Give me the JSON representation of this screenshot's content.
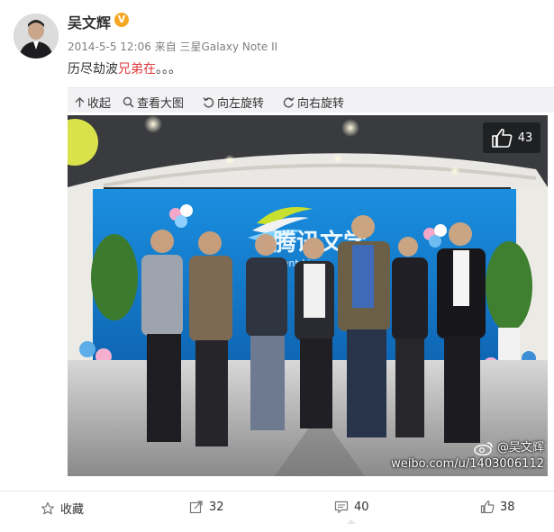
{
  "post": {
    "author": "吴文辉",
    "verified_badge": "V",
    "timestamp": "2014-5-5 12:06",
    "source_prefix": "来自",
    "source_device": "三星Galaxy Note II",
    "text_before": "历尽劫波",
    "text_highlight": "兄弟在",
    "text_after": "。。。"
  },
  "toolbar": {
    "collapse": "收起",
    "view_large": "查看大图",
    "rotate_left": "向左旋转",
    "rotate_right": "向右旋转"
  },
  "photo": {
    "like_count": "43",
    "watermark_handle": "@吴文辉",
    "watermark_url": "weibo.com/u/1403006112",
    "sign_text_cn": "腾讯文学",
    "sign_text_en": "Tencent Li"
  },
  "footer": {
    "favorite": "收藏",
    "repost_count": "32",
    "comment_count": "40",
    "like_count": "38"
  },
  "colors": {
    "highlight": "#e0373a",
    "badge": "#f6a623",
    "toolbar_bg": "#f2f2f5",
    "meta_gray": "#808080"
  }
}
